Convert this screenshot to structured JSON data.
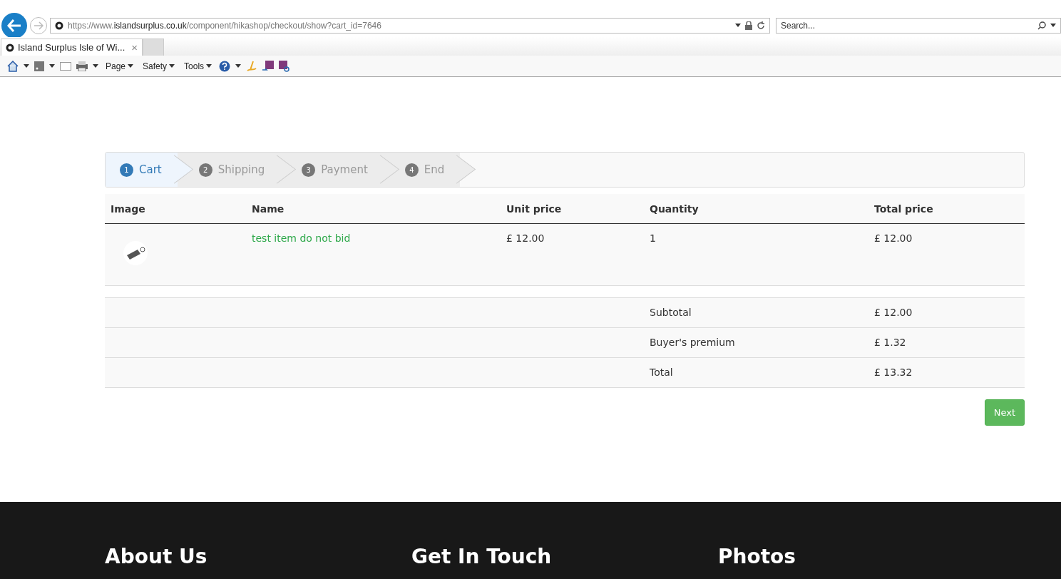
{
  "browser": {
    "url": "https://www.**islandsurplus.co.uk**/component/hikashop/checkout/show?cart_id=7646",
    "search": {
      "placeholder": "Search..."
    },
    "tabs": [
      {
        "title": "Island Surplus Isle of Wi...",
        "close": "×",
        "selected": true
      }
    ],
    "toolbar": [
      "Page",
      "Safety",
      "Tools"
    ]
  },
  "steps": [
    {
      "number": "1",
      "label": "Cart",
      "selected": true
    },
    {
      "number": "2",
      "label": "Shipping",
      "selected": false
    },
    {
      "number": "3",
      "label": "Payment",
      "selected": false
    },
    {
      "number": "4",
      "label": "End",
      "selected": false
    }
  ],
  "cart": {
    "columns": [
      "Image",
      "Name",
      "Unit price",
      "Quantity",
      "Total price"
    ],
    "rows": [
      {
        "name": "test item do not bid",
        "unit_price": "£ 12.00",
        "quantity": "1",
        "total_price": "£ 12.00"
      }
    ],
    "totals": [
      {
        "label": "Subtotal",
        "value": "£ 12.00"
      },
      {
        "label": "Buyer's premium",
        "value": "£ 1.32"
      },
      {
        "label": "Total",
        "value": "£ 13.32"
      }
    ]
  },
  "next_button": "Next",
  "footer": [
    "About Us",
    "Get In Touch",
    "Photos"
  ]
}
